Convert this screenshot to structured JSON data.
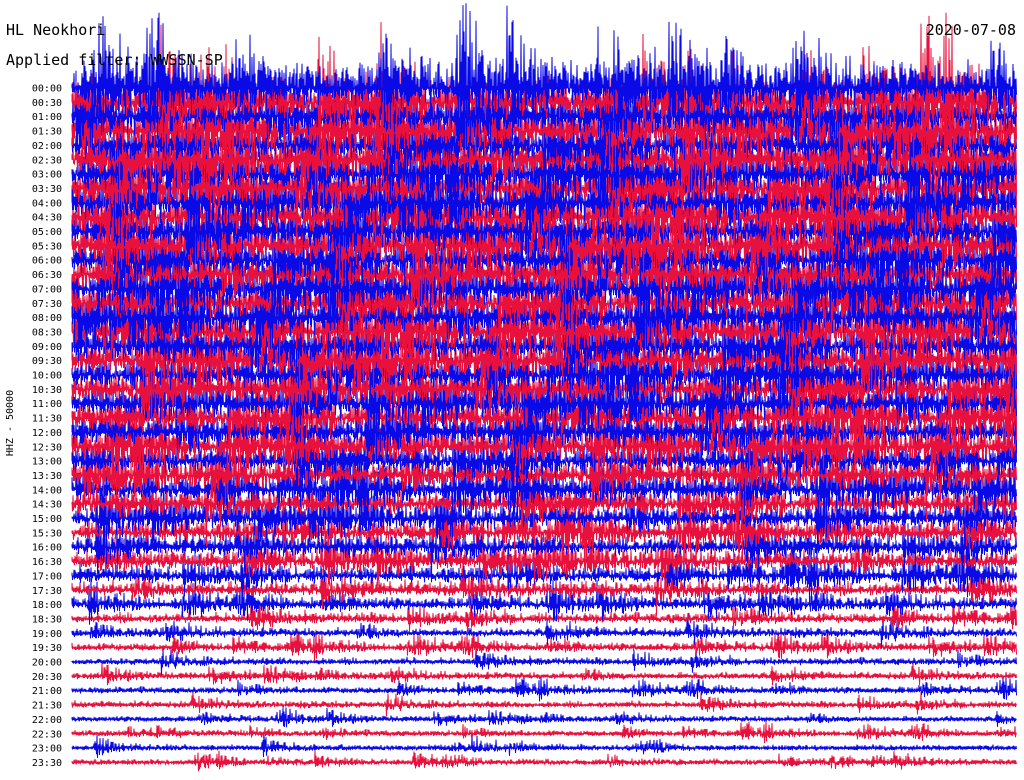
{
  "chart_data": {
    "type": "line",
    "title": "HL Neokhori",
    "subtitle": "Applied filter: WWSSN-SP",
    "date": "2020-07-08",
    "ylabel": "HHZ - 50000",
    "row_labels": [
      "00:00",
      "00:30",
      "01:00",
      "01:30",
      "02:00",
      "02:30",
      "03:00",
      "03:30",
      "04:00",
      "04:30",
      "05:00",
      "05:30",
      "06:00",
      "06:30",
      "07:00",
      "07:30",
      "08:00",
      "08:30",
      "09:00",
      "09:30",
      "10:00",
      "10:30",
      "11:00",
      "11:30",
      "12:00",
      "12:30",
      "13:00",
      "13:30",
      "14:00",
      "14:30",
      "15:00",
      "15:30",
      "16:00",
      "16:30",
      "17:00",
      "17:30",
      "18:00",
      "18:30",
      "19:00",
      "19:30",
      "20:00",
      "20:30",
      "21:00",
      "21:30",
      "22:00",
      "22:30",
      "23:00",
      "23:30"
    ],
    "series_colors": [
      "#e8103c",
      "#0a0ae6"
    ],
    "relative_amplitude": [
      1.0,
      1.0,
      0.98,
      0.97,
      0.97,
      0.96,
      0.96,
      0.95,
      0.95,
      0.94,
      0.94,
      0.93,
      0.93,
      0.92,
      0.92,
      0.91,
      0.9,
      0.89,
      0.88,
      0.86,
      0.84,
      0.82,
      0.8,
      0.78,
      0.76,
      0.73,
      0.7,
      0.67,
      0.64,
      0.6,
      0.56,
      0.52,
      0.5,
      0.46,
      0.42,
      0.36,
      0.3,
      0.26,
      0.22,
      0.2,
      0.18,
      0.17,
      0.16,
      0.16,
      0.14,
      0.14,
      0.14,
      0.14
    ]
  }
}
